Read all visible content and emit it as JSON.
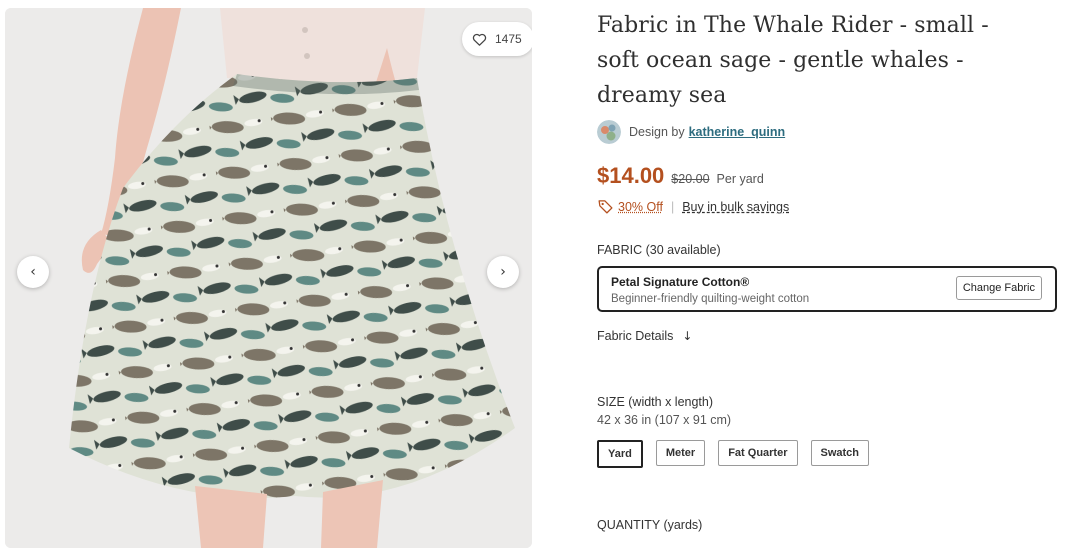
{
  "gallery": {
    "favorites_count": "1475",
    "icons": {
      "favorite": "heart-icon",
      "prev": "chevron-left-icon",
      "next": "chevron-right-icon"
    },
    "prev_glyph": "‹",
    "next_glyph": "›"
  },
  "product": {
    "title": "Fabric in The Whale Rider - small - soft ocean sage - gentle whales - dreamy sea",
    "designer_prefix": "Design by",
    "designer_name": "katherine_quinn",
    "price": "$14.00",
    "original_price": "$20.00",
    "price_unit": "Per yard",
    "discount": "30% Off",
    "separator": "|",
    "bulk_savings": "Buy in bulk savings"
  },
  "fabric": {
    "label": "FABRIC (30 available)",
    "name": "Petal Signature Cotton®",
    "description": "Beginner-friendly quilting-weight cotton",
    "change_button": "Change Fabric",
    "details_link": "Fabric Details",
    "details_glyph": "↓"
  },
  "size": {
    "label": "SIZE (width x length)",
    "dimensions": "42 x 36 in (107 x 91 cm)",
    "options": [
      "Yard",
      "Meter",
      "Fat Quarter",
      "Swatch"
    ],
    "selected": "Yard"
  },
  "quantity": {
    "label": "QUANTITY (yards)"
  },
  "colors": {
    "price": "#b4501f",
    "link": "#2d6c7f",
    "fabric_bg": "#dfe2d6"
  }
}
